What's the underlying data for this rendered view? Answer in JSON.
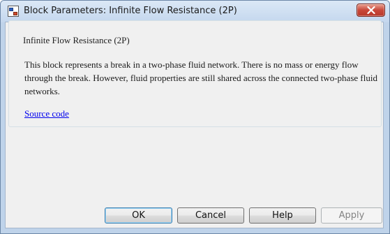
{
  "window": {
    "title": "Block Parameters: Infinite Flow Resistance (2P)"
  },
  "group": {
    "title": "Infinite Flow Resistance (2P)",
    "description": "This block represents a break in a two-phase fluid network. There is no mass or energy flow through the break. However, fluid properties are still shared across the connected two-phase fluid networks.",
    "link_label": "Source code"
  },
  "buttons": {
    "ok": "OK",
    "cancel": "Cancel",
    "help": "Help",
    "apply": "Apply"
  },
  "icons": {
    "app": "simulink-block-icon",
    "close": "close-icon"
  },
  "colors": {
    "close_button": "#c9483a",
    "link": "#0000ee",
    "default_button_border": "#3c7fb1"
  }
}
